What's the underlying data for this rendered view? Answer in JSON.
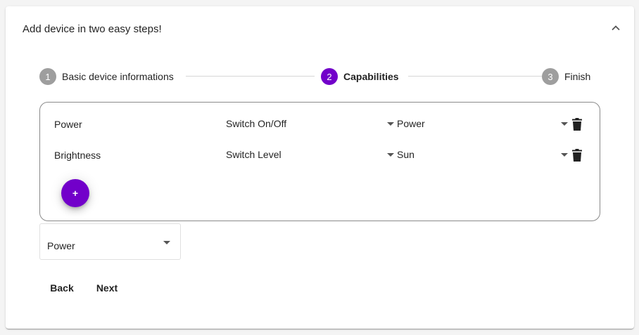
{
  "card": {
    "title": "Add device in two easy steps!",
    "collapse_icon": "chevron-up-icon"
  },
  "stepper": {
    "steps": [
      {
        "number": "1",
        "label": "Basic device informations",
        "state": "completed"
      },
      {
        "number": "2",
        "label": "Capabilities",
        "state": "active"
      },
      {
        "number": "3",
        "label": "Finish",
        "state": "upcoming"
      }
    ]
  },
  "capabilities": {
    "rows": [
      {
        "name": "Power",
        "type": "Switch On/Off",
        "icon_value": "Power"
      },
      {
        "name": "Brightness",
        "type": "Switch Level",
        "icon_value": "Sun"
      }
    ],
    "add_button_label": "+"
  },
  "power_select": {
    "value": "Power"
  },
  "actions": {
    "back_label": "Back",
    "next_label": "Next"
  },
  "colors": {
    "accent": "#7200ca",
    "step_inactive": "#9e9e9e"
  }
}
